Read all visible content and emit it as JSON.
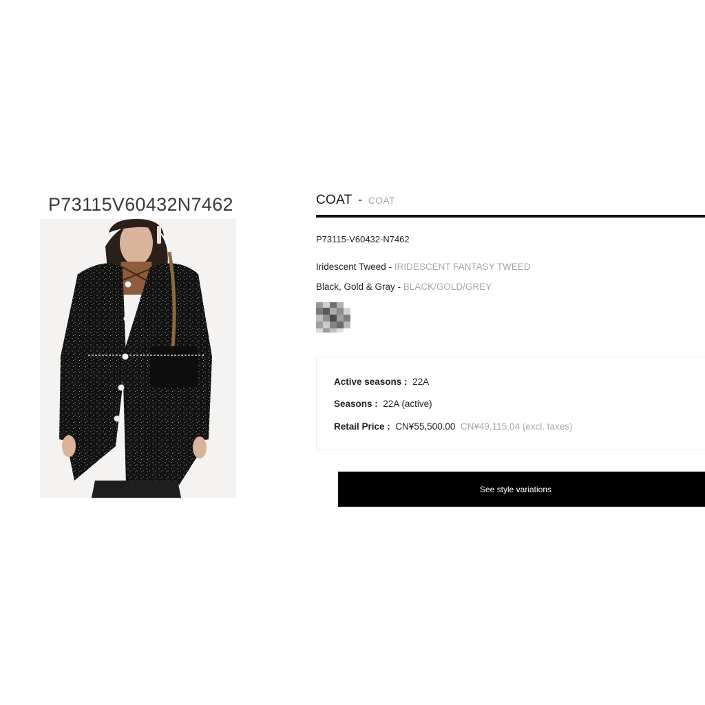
{
  "left": {
    "code": "P73115V60432N7462",
    "photo": "product-photo"
  },
  "product": {
    "category": "COAT",
    "category_sub": "COAT",
    "separator": "-",
    "reference": "P73115-V60432-N7462",
    "material_label": "Iridescent Tweed",
    "material_value": "IRIDESCENT FANTASY TWEED",
    "color_label": "Black, Gold & Gray",
    "color_value": "BLACK/GOLD/GREY",
    "attr_separator": " - "
  },
  "info": {
    "active_seasons_label": "Active seasons :",
    "active_seasons_value": "22A",
    "seasons_label": "Seasons :",
    "seasons_value": "22A (active)",
    "retail_price_label": "Retail Price :",
    "retail_price_value": "CN¥55,500.00",
    "retail_price_excl": "CN¥49,115.04 (excl. taxes)"
  },
  "actions": {
    "variations_label": "See style variations"
  },
  "colors": {
    "accent": "#000000",
    "muted_text": "#a9a9a9",
    "rule": "#111111"
  }
}
